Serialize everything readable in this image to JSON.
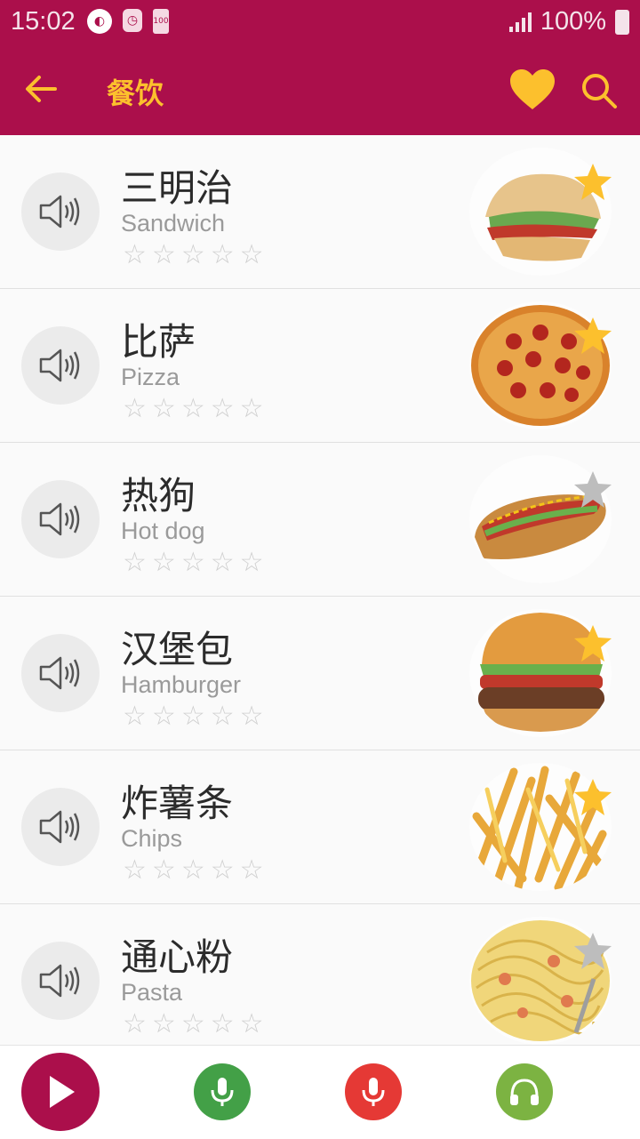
{
  "status": {
    "time": "15:02",
    "battery": "100%",
    "battery_small_icon_text": "100"
  },
  "header": {
    "title": "餐饮"
  },
  "items": [
    {
      "zh": "三明治",
      "en": "Sandwich",
      "favorite": true,
      "image": "sandwich"
    },
    {
      "zh": "比萨",
      "en": "Pizza",
      "favorite": true,
      "image": "pizza"
    },
    {
      "zh": "热狗",
      "en": "Hot dog",
      "favorite": false,
      "image": "hotdog"
    },
    {
      "zh": "汉堡包",
      "en": "Hamburger",
      "favorite": true,
      "image": "hamburger"
    },
    {
      "zh": "炸薯条",
      "en": "Chips",
      "favorite": true,
      "image": "chips"
    },
    {
      "zh": "通心粉",
      "en": "Pasta",
      "favorite": false,
      "image": "pasta"
    }
  ],
  "colors": {
    "primary": "#ab0f4b",
    "accent": "#fcc02d",
    "star_off": "#bdbdbd",
    "mic_green": "#43a047",
    "mic_red": "#e53935",
    "headphones_green": "#7cb342"
  },
  "icons": {
    "back": "arrow-left-icon",
    "favorites": "heart-icon",
    "search": "search-icon",
    "play": "play-icon",
    "practice": "mic-icon",
    "record": "mic-icon",
    "listen": "headphones-icon",
    "speaker": "speaker-icon"
  }
}
